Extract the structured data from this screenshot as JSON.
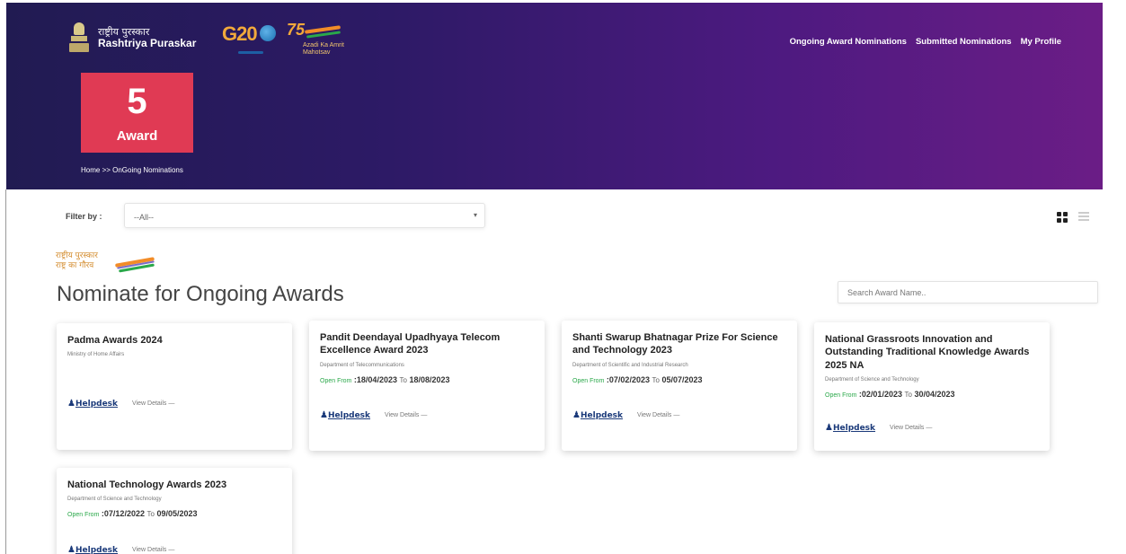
{
  "brand": {
    "hindi": "राष्ट्रीय पुरस्कार",
    "name": "Rashtriya Puraskar",
    "g20_text": "G20",
    "amrit_number": "75",
    "amrit_text": "Azadi Ka Amrit Mahotsav"
  },
  "nav": {
    "items": [
      "Ongoing Award Nominations",
      "Submitted Nominations",
      "My Profile"
    ]
  },
  "award_count": {
    "number": "5",
    "label": "Award"
  },
  "breadcrumb": "Home >> OnGoing Nominations",
  "filter": {
    "label": "Filter by :",
    "selected": "--All--",
    "caret": "▾"
  },
  "section": {
    "logo_hindi_1": "राष्ट्रीय पुरस्कार",
    "logo_hindi_2": "राष्ट्र का गौरव",
    "title": "Nominate for Ongoing Awards",
    "search_placeholder": "Search Award Name.."
  },
  "cards": [
    {
      "title": "Padma Awards 2024",
      "dept": "Ministry of Home Affairs",
      "open_label": "",
      "from": "",
      "to_label": "",
      "to": "",
      "helpdesk": "Helpdesk",
      "view": "View Details —"
    },
    {
      "title": "Pandit Deendayal Upadhyaya Telecom Excellence Award 2023",
      "dept": "Department of Telecommunications",
      "open_label": "Open From",
      "from": ":18/04/2023",
      "to_label": "To",
      "to": "18/08/2023",
      "helpdesk": "Helpdesk",
      "view": "View Details —"
    },
    {
      "title": "Shanti Swarup Bhatnagar Prize For Science and Technology 2023",
      "dept": "Department of Scientific and Industrial Research",
      "open_label": "Open From",
      "from": ":07/02/2023",
      "to_label": "To",
      "to": "05/07/2023",
      "helpdesk": "Helpdesk",
      "view": "View Details —"
    },
    {
      "title": "National Grassroots Innovation and Outstanding Traditional Knowledge Awards 2025 NA",
      "dept": "Department of Science and Technology",
      "open_label": "Open From",
      "from": ":02/01/2023",
      "to_label": "To",
      "to": "30/04/2023",
      "helpdesk": "Helpdesk",
      "view": "View Details —"
    },
    {
      "title": "National Technology Awards 2023",
      "dept": "Department of Science and Technology",
      "open_label": "Open From",
      "from": ":07/12/2022",
      "to_label": "To",
      "to": "09/05/2023",
      "helpdesk": "Helpdesk",
      "view": "View Details —"
    }
  ],
  "icons": {
    "helpdesk": "person-icon",
    "grid_view": "grid-view-icon",
    "list_view": "list-view-icon"
  }
}
